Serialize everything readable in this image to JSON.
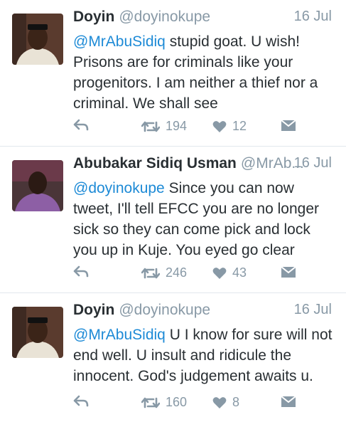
{
  "tweets": [
    {
      "name": "Doyin",
      "handle": "@doyinokupe",
      "date": "16 Jul",
      "mention": "@MrAbuSidiq",
      "body": "  stupid goat. U wish! Prisons are for criminals like your progenitors. I am neither a thief nor a criminal. We shall see",
      "retweets": "194",
      "likes": "12"
    },
    {
      "name": "Abubakar Sidiq Usman",
      "handle": "@MrAb...",
      "date": "16 Jul",
      "mention": "@doyinokupe",
      "body": " Since you can now tweet, I'll tell EFCC you are no longer sick so they can come pick and lock you up in Kuje. You eyed go clear",
      "retweets": "246",
      "likes": "43"
    },
    {
      "name": "Doyin",
      "handle": "@doyinokupe",
      "date": "16 Jul",
      "mention": "@MrAbuSidiq",
      "body": " U I know for sure will not end well. U insult and ridicule the innocent. God's judgement awaits u.",
      "retweets": "160",
      "likes": "8"
    }
  ],
  "icons": {
    "reply": "reply-icon",
    "retweet": "retweet-icon",
    "like": "heart-icon",
    "message": "direct-message-icon"
  },
  "colors": {
    "accent": "#1d8ad6",
    "muted": "#8899a6",
    "text": "#292f33"
  }
}
